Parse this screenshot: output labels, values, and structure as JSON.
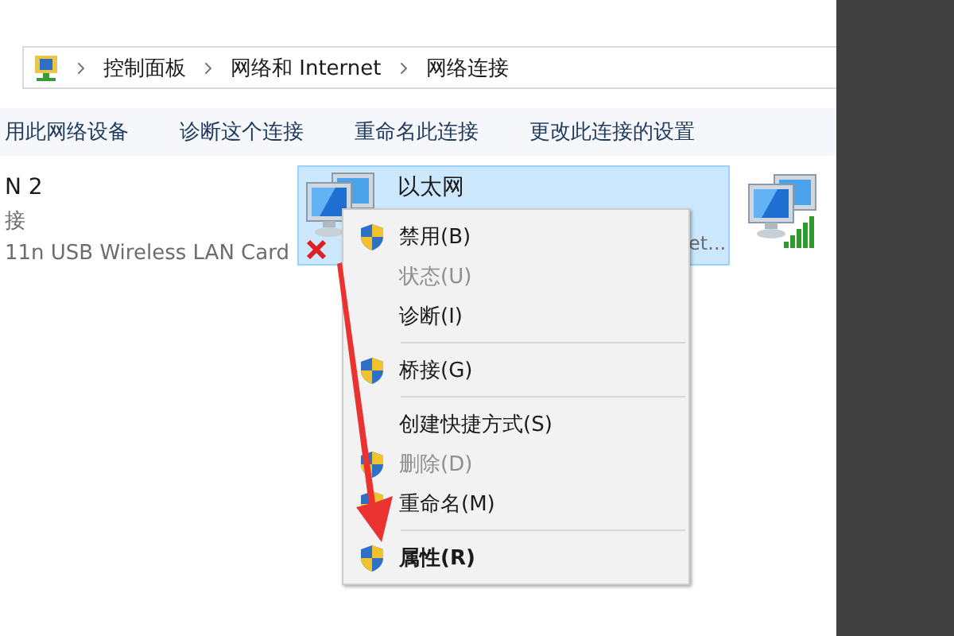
{
  "breadcrumb": [
    "控制面板",
    "网络和 Internet",
    "网络连接"
  ],
  "toolbar": [
    "用此网络设备",
    "诊断这个连接",
    "重命名此连接",
    "更改此连接的设置"
  ],
  "connections": [
    {
      "kind": "text",
      "selected": false,
      "name": "N 2",
      "status": "接",
      "device": "11n USB Wireless LAN Card"
    },
    {
      "kind": "ethernet",
      "selected": true,
      "disconnected": true,
      "name": "以太网",
      "device": "et..."
    },
    {
      "kind": "wifi",
      "selected": false
    }
  ],
  "context_menu": [
    {
      "kind": "item",
      "label": "禁用(B)",
      "shield": true,
      "disabled": false,
      "default": false
    },
    {
      "kind": "item",
      "label": "状态(U)",
      "shield": false,
      "disabled": true,
      "default": false
    },
    {
      "kind": "item",
      "label": "诊断(I)",
      "shield": false,
      "disabled": false,
      "default": false
    },
    {
      "kind": "separator"
    },
    {
      "kind": "item",
      "label": "桥接(G)",
      "shield": true,
      "disabled": false,
      "default": false
    },
    {
      "kind": "separator"
    },
    {
      "kind": "item",
      "label": "创建快捷方式(S)",
      "shield": false,
      "disabled": false,
      "default": false
    },
    {
      "kind": "item",
      "label": "删除(D)",
      "shield": true,
      "disabled": true,
      "default": false
    },
    {
      "kind": "item",
      "label": "重命名(M)",
      "shield": true,
      "disabled": false,
      "default": false
    },
    {
      "kind": "separator"
    },
    {
      "kind": "item",
      "label": "属性(R)",
      "shield": true,
      "disabled": false,
      "default": true
    }
  ]
}
